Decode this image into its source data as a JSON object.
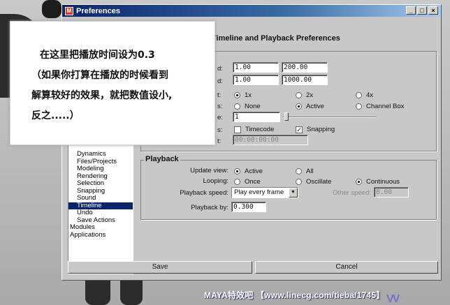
{
  "window": {
    "title": "Preferences",
    "controls": [
      "_",
      "□",
      "×"
    ]
  },
  "pane": {
    "title": "Timeline and Playback Preferences"
  },
  "categories": [
    {
      "label": "Dynamics",
      "indent": true,
      "selected": false
    },
    {
      "label": "Files/Projects",
      "indent": true,
      "selected": false
    },
    {
      "label": "Modeling",
      "indent": true,
      "selected": false
    },
    {
      "label": "Rendering",
      "indent": true,
      "selected": false
    },
    {
      "label": "Selection",
      "indent": true,
      "selected": false
    },
    {
      "label": "Snapping",
      "indent": true,
      "selected": false
    },
    {
      "label": "Sound",
      "indent": true,
      "selected": false
    },
    {
      "label": "Timeline",
      "indent": true,
      "selected": true
    },
    {
      "label": "Undo",
      "indent": true,
      "selected": false
    },
    {
      "label": "Save Actions",
      "indent": true,
      "selected": false
    },
    {
      "label": "Modules",
      "indent": false,
      "selected": false
    },
    {
      "label": "Applications",
      "indent": false,
      "selected": false
    }
  ],
  "time_slider": {
    "labels": [
      "d:",
      "d:",
      "t:",
      "s:",
      "e:",
      "s:",
      "t:"
    ],
    "playback_start": "1.00",
    "playback_end": "200.00",
    "anim_start": "1.00",
    "anim_end": "1000.00",
    "height_options": [
      {
        "label": "1x",
        "on": true
      },
      {
        "label": "2x",
        "on": false
      },
      {
        "label": "4x",
        "on": false
      }
    ],
    "key_ticks_options": [
      {
        "label": "None",
        "on": false
      },
      {
        "label": "Active",
        "on": true
      },
      {
        "label": "Channel Box",
        "on": false
      }
    ],
    "key_tick_size": "1",
    "options": [
      {
        "label": "Timecode",
        "checked": false
      },
      {
        "label": "Snapping",
        "checked": true
      }
    ],
    "timecode_offset": "00:00:00:00"
  },
  "playback": {
    "title": "Playback",
    "update_view_label": "Update view:",
    "update_view_options": [
      {
        "label": "Active",
        "on": true
      },
      {
        "label": "All",
        "on": false
      }
    ],
    "looping_label": "Looping:",
    "looping_options": [
      {
        "label": "Once",
        "on": false
      },
      {
        "label": "Oscillate",
        "on": false
      },
      {
        "label": "Continuous",
        "on": true
      }
    ],
    "speed_label": "Playback speed:",
    "speed_value": "Play every frame",
    "other_speed_label": "Other speed:",
    "other_speed_value": "0.00",
    "by_label": "Playback by:",
    "by_value": "0.300"
  },
  "buttons": {
    "save": "Save",
    "cancel": "Cancel"
  },
  "callout": {
    "line1": "在这里把播放时间设为0.3",
    "line2": "（如果你打算在播放的时候看到",
    "line3": "解算较好的效果，就把数值设小,",
    "line4": "反之.....）"
  },
  "watermark": {
    "text": "MAYA特效吧 【www.linecg.com/tieba/1745】"
  },
  "colors": {
    "title_bar": "#0a246a",
    "window_bg": "#c8c8c8",
    "selection": "#0a246a"
  }
}
